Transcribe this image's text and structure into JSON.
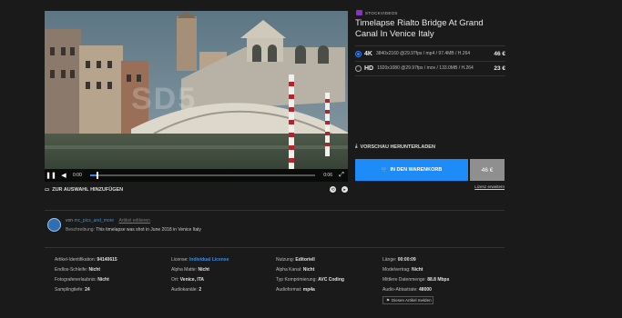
{
  "player": {
    "watermark": "SD5",
    "current_time": "0:00",
    "duration": "0:06",
    "progress": 0.03
  },
  "product": {
    "badge": "STOCKVIDEOS",
    "title": "Timelapse Rialto Bridge At Grand Canal In Venice Italy",
    "options": [
      {
        "quality": "4K",
        "spec": "3840x2160 @29.97fps / mp4 / 97.4MB / H.264",
        "price": "46 €",
        "selected": true
      },
      {
        "quality": "HD",
        "spec": "1920x1080 @29.97fps / mov / 133.0MB / H.264",
        "price": "23 €",
        "selected": false
      }
    ],
    "download_preview": "VORSCHAU HERUNTERLADEN",
    "cart_button": "IN DEN WARENKORB",
    "cart_price": "46 €",
    "extend_license": "Lizenz erweitern"
  },
  "actions": {
    "add_selection": "ZUR AUSWAHL HINZUFÜGEN"
  },
  "author": {
    "by": "von",
    "username": "mc_pics_and_more",
    "edit": "Artikel editieren",
    "desc_label": "Beschreibung:",
    "description": "This timelapse was shot in June 2018 in Venice Italy"
  },
  "meta": {
    "col1": [
      {
        "label": "Artikel-Identifikation:",
        "value": "94140615"
      },
      {
        "label": "Endlos-Schleife:",
        "value": "Nicht"
      },
      {
        "label": "Fotografenerlaubnis:",
        "value": "Nicht"
      },
      {
        "label": "Samplingtiefe:",
        "value": "24"
      }
    ],
    "col2": [
      {
        "label": "License:",
        "value": "Individual License"
      },
      {
        "label": "Alpha Matte:",
        "value": "Nicht"
      },
      {
        "label": "Ort:",
        "value": "Venice, ITA"
      },
      {
        "label": "Audiokanäle:",
        "value": "2"
      }
    ],
    "col3": [
      {
        "label": "Nutzung:",
        "value": "Editoriell"
      },
      {
        "label": "Alpha Kanal:",
        "value": "Nicht"
      },
      {
        "label": "Typ Komprimierung:",
        "value": "AVC Coding"
      },
      {
        "label": "Audioformat:",
        "value": "mp4a"
      }
    ],
    "col4": [
      {
        "label": "Länge:",
        "value": "00:00:09"
      },
      {
        "label": "Modelvertrag:",
        "value": "Nicht"
      },
      {
        "label": "Mittlere Datenmenge:",
        "value": "88.8 Mbps"
      },
      {
        "label": "Audio-Abtastrate:",
        "value": "48000"
      }
    ],
    "report": "Diesen Artikel melden"
  }
}
